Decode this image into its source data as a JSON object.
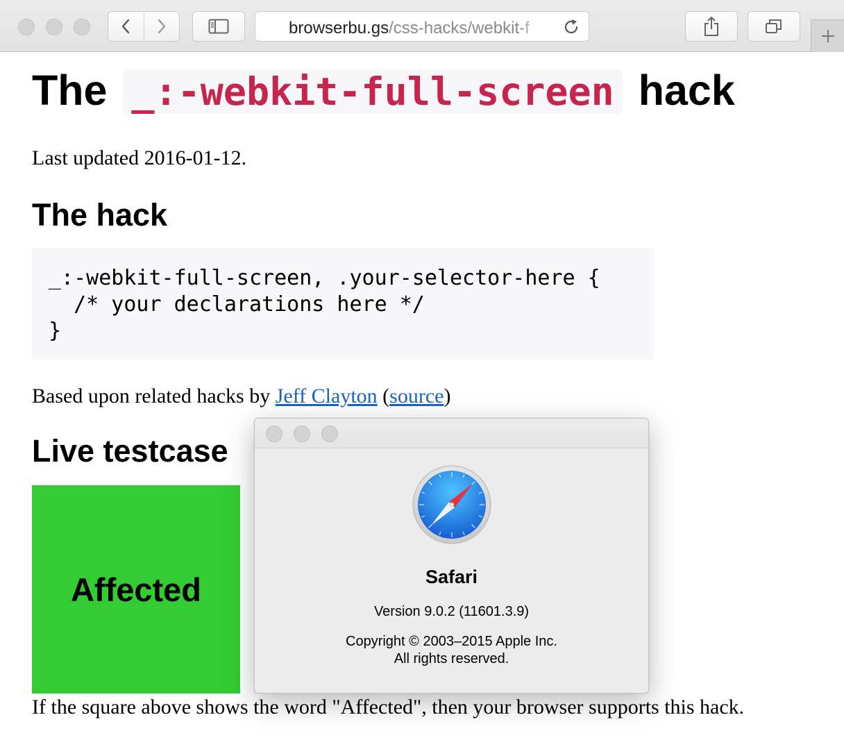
{
  "browser": {
    "address": {
      "host": "browserbu.gs",
      "path": "/css-hacks/webkit-f"
    },
    "icons": {
      "back": "chevron-left-icon",
      "forward": "chevron-right-icon",
      "sidebar": "sidebar-icon",
      "reload": "reload-icon",
      "share": "share-icon",
      "tabs": "tabs-overview-icon",
      "new_tab": "plus-icon"
    }
  },
  "page": {
    "title_before": "The",
    "title_code": "_:-webkit-full-screen",
    "title_after": "hack",
    "updated": "Last updated 2016-01-12.",
    "hack_heading": "The hack",
    "code_lines": [
      "_:-webkit-full-screen, .your-selector-here {",
      "  /* your declarations here */",
      "}"
    ],
    "based_prefix": "Based upon related hacks by ",
    "based_link": "Jeff Clayton",
    "based_mid": " (",
    "based_source": "source",
    "based_suffix": ")",
    "live_heading": "Live testcase",
    "square_label": "Affected",
    "square_color": "#33cc33",
    "explanation": "If the square above shows the word \"Affected\", then your browser supports this hack."
  },
  "about_dialog": {
    "app_name": "Safari",
    "version": "Version 9.0.2 (11601.3.9)",
    "copyright_line1": "Copyright © 2003–2015 Apple Inc.",
    "copyright_line2": "All rights reserved.",
    "icon": "safari-compass-icon"
  },
  "colors": {
    "code_accent": "#c7254e",
    "link": "#1a63c5"
  }
}
